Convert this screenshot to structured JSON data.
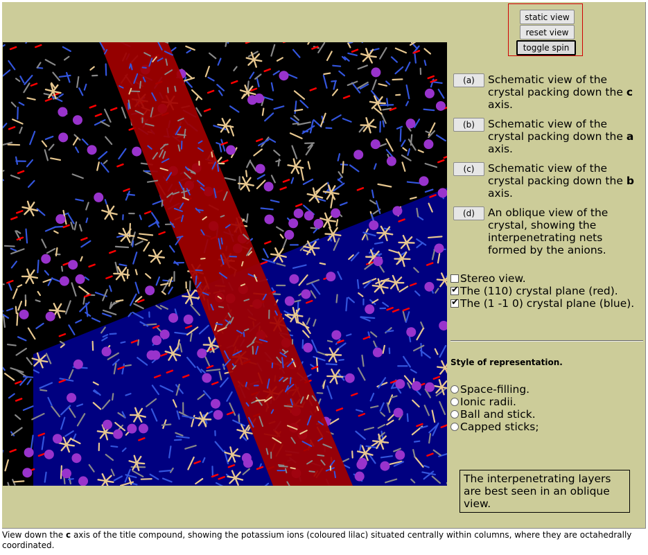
{
  "controls": {
    "static_view": "static view",
    "reset_view": "reset view",
    "toggle_spin": "toggle spin"
  },
  "options": [
    {
      "button": "(a)",
      "pre": "Schematic view of the crystal packing down the ",
      "axis": "c",
      "post": " axis."
    },
    {
      "button": "(b)",
      "pre": "Schematic view of the crystal packing down the ",
      "axis": "a",
      "post": " axis."
    },
    {
      "button": "(c)",
      "pre": "Schematic view of the crystal packing down the ",
      "axis": "b",
      "post": " axis."
    },
    {
      "button": "(d)",
      "pre": "An oblique view of the crystal, showing the interpenetrating nets formed by the anions.",
      "axis": "",
      "post": ""
    }
  ],
  "checkboxes": [
    {
      "label": "Stereo view.",
      "checked": false
    },
    {
      "label": "The (110) crystal plane (red).",
      "checked": true
    },
    {
      "label": "The (1 -1 0) crystal plane (blue).",
      "checked": true
    }
  ],
  "style_heading": "Style of representation.",
  "styles": [
    "Space-filling.",
    "Ionic radii.",
    "Ball and stick.",
    "Capped sticks;"
  ],
  "info_text": "The interpenetrating layers are best seen in an oblique view.",
  "caption": {
    "pre": "View down the ",
    "axis": "c",
    "post": " axis of the title compound, showing the potassium ions (coloured lilac) situated centrally within columns, where they are octahedrally coordinated."
  },
  "colors": {
    "background": "#cccc99",
    "red_plane": "#a00000",
    "blue_plane": "#000080",
    "potassium": "#9933cc",
    "nitrogen": "#3355dd",
    "carbon": "#888888",
    "oxygen": "#ff0000",
    "metal": "#e8c890"
  }
}
